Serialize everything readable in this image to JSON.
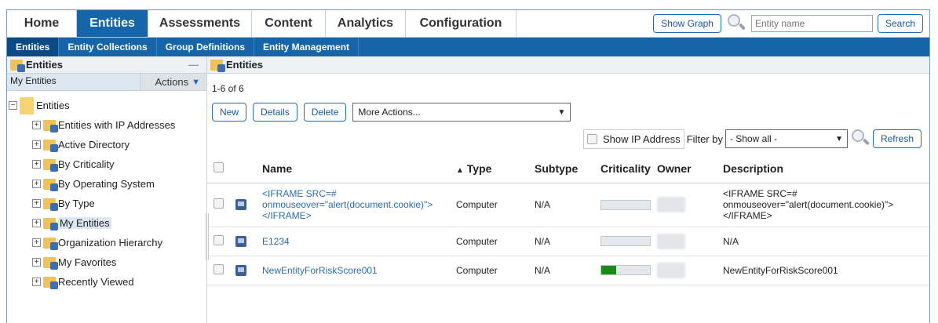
{
  "topnav": {
    "tabs": [
      "Home",
      "Entities",
      "Assessments",
      "Content",
      "Analytics",
      "Configuration"
    ],
    "active": "Entities",
    "show_graph": "Show Graph",
    "search_placeholder": "Entity name",
    "search_button": "Search"
  },
  "subnav": [
    "Entities",
    "Entity Collections",
    "Group Definitions",
    "Entity Management"
  ],
  "left": {
    "title": "Entities",
    "minimize": "—",
    "tab": "My Entities",
    "actions": "Actions",
    "root": "Entities",
    "items": [
      "Entities with IP Addresses",
      "Active Directory",
      "By Criticality",
      "By Operating System",
      "By Type",
      "My Entities",
      "Organization Hierarchy",
      "My Favorites",
      "Recently Viewed"
    ],
    "selected": "My Entities"
  },
  "right": {
    "title": "Entities",
    "count": "1-6 of 6",
    "buttons": {
      "new": "New",
      "details": "Details",
      "delete": "Delete"
    },
    "more_actions": "More Actions...",
    "show_ip": "Show IP Address",
    "filter_label": "Filter by",
    "filter_value": "- Show all -",
    "refresh": "Refresh",
    "columns": [
      "Name",
      "Type",
      "Subtype",
      "Criticality",
      "Owner",
      "Description"
    ],
    "sort_arrow": "▲",
    "rows": [
      {
        "name": "<IFRAME SRC=# onmouseover=\"alert(document.cookie)\"></IFRAME>",
        "type": "Computer",
        "subtype": "N/A",
        "criticality": 0,
        "description": "<IFRAME SRC=# onmouseover=\"alert(document.cookie)\"></IFRAME>"
      },
      {
        "name": "E1234",
        "type": "Computer",
        "subtype": "N/A",
        "criticality": 0,
        "description": "N/A"
      },
      {
        "name": "NewEntityForRiskScore001",
        "type": "Computer",
        "subtype": "N/A",
        "criticality": 0.3,
        "description": "NewEntityForRiskScore001"
      }
    ]
  }
}
